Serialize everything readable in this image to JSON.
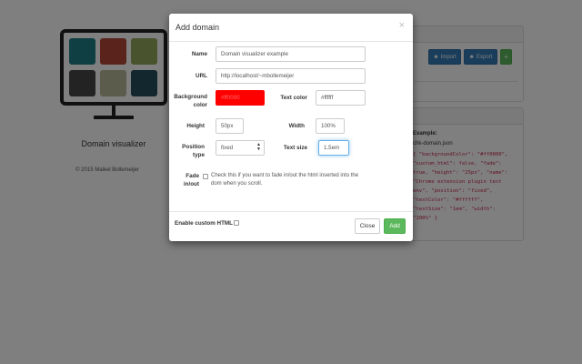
{
  "background_page": {
    "app_title": "Domain visualizer",
    "copyright": "© 2015 Maikel Bollemeijer",
    "tile_colors": [
      "#1e7f86",
      "#b5493a",
      "#93a65a",
      "#474747",
      "#b8b89a",
      "#244f5c"
    ],
    "import_label": "Import",
    "export_label": "Export",
    "add_label": "+",
    "example": {
      "title": "Example:",
      "file": "chk-domain.json",
      "code": "{ \"backgroundColor\": \"#ff0000\",\n\"custom_html\": false, \"fade\":\ntrue, \"height\": \"25px\", \"name\":\n\"Chrome extension plugin test\nenv\", \"position\": \"fixed\",\n\"textColor\": \"#ffffff\",\n\"textSize\": \"1em\", \"width\":\n\"100%\" }"
    }
  },
  "modal": {
    "title": "Add domain",
    "close_glyph": "×",
    "name": {
      "label": "Name",
      "value": "Domain visualizer example"
    },
    "url": {
      "label": "URL",
      "value": "http://localhost/~mbollemeijer"
    },
    "background_color": {
      "label_line1": "Background",
      "label_line2": "color",
      "value": "#ff0000",
      "color": "#ff0000"
    },
    "text_color": {
      "label": "Text color",
      "value": "#ffffff"
    },
    "height": {
      "label": "Height",
      "value": "50px"
    },
    "width": {
      "label": "Width",
      "value": "100%"
    },
    "position_type": {
      "label_line1": "Position",
      "label_line2": "type",
      "value": "fixed"
    },
    "text_size": {
      "label": "Text size",
      "value": "1.5em"
    },
    "fade": {
      "label_line1": "Fade",
      "label_line2": "in/out",
      "help_line1": "Check this if you want to fade in/out the html inserted into the",
      "help_line2": "dom when you scroll."
    },
    "custom_html": {
      "label": "Enable custom HTML"
    },
    "close_label": "Close",
    "add_label": "Add"
  },
  "colors": {
    "primary": "#337ab7",
    "success": "#5cb85c",
    "backdrop": "rgba(0,0,0,0.5)"
  }
}
